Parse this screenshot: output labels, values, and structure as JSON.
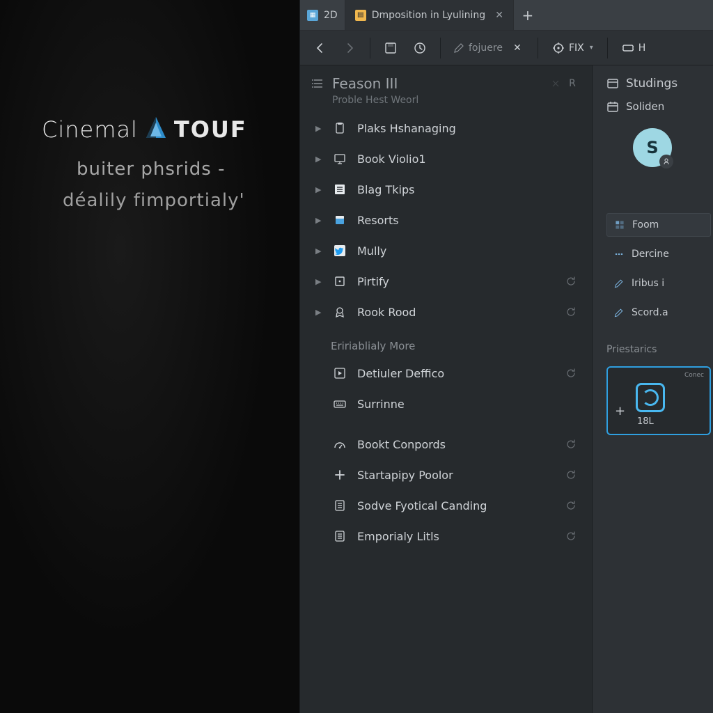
{
  "splash": {
    "brand_left": "Cinemal",
    "brand_right": "TOUF",
    "tagline1": "buiter phsrids -",
    "tagline2": "déalily fimportialy'"
  },
  "tabs": {
    "small_label": "2D",
    "active_label": "Dmposition in Lyulining",
    "add_tooltip": "+"
  },
  "toolbar": {
    "edit_placeholder": "fojuere",
    "fix_label": "FIX",
    "h_label": "H"
  },
  "tree": {
    "header": "Feason III",
    "subheader": "Proble Hest Weorl",
    "hdr_btn_r": "R",
    "items_a": [
      {
        "label": "Plaks Hshanaging",
        "icon": "clipboard",
        "refresh": false
      },
      {
        "label": "Book Violio1",
        "icon": "presentation",
        "refresh": false
      },
      {
        "label": "Blag Tkips",
        "icon": "list",
        "refresh": false
      },
      {
        "label": "Resorts",
        "icon": "box-blue",
        "refresh": false
      },
      {
        "label": "Mully",
        "icon": "twitter",
        "refresh": false
      },
      {
        "label": "Pirtify",
        "icon": "square",
        "refresh": true
      },
      {
        "label": "Rook Rood",
        "icon": "badge",
        "refresh": true
      }
    ],
    "section_a": "Eririablialy More",
    "items_b": [
      {
        "label": "Detiuler Deffico",
        "icon": "play",
        "refresh": true
      },
      {
        "label": "Surrinne",
        "icon": "keyboard",
        "refresh": false
      }
    ],
    "items_c": [
      {
        "label": "Bookt Conpords",
        "icon": "gauge",
        "refresh": true
      },
      {
        "label": "Startapipy Poolor",
        "icon": "plus",
        "refresh": true
      },
      {
        "label": "Sodve Fyotical Canding",
        "icon": "doc",
        "refresh": true
      },
      {
        "label": "Emporialy Litls",
        "icon": "doc",
        "refresh": true
      }
    ]
  },
  "rpanel": {
    "header": "Studings",
    "row1": "Soliden",
    "avatar_letter": "S",
    "buttons": [
      {
        "label": "Foom",
        "icon": "grid"
      },
      {
        "label": "Dercine",
        "icon": "dots"
      },
      {
        "label": "Iribus i",
        "icon": "pencil"
      },
      {
        "label": "Scord.a",
        "icon": "pencil"
      }
    ],
    "section": "Priestarics",
    "card_label": "Conec",
    "card_value": "18L"
  }
}
